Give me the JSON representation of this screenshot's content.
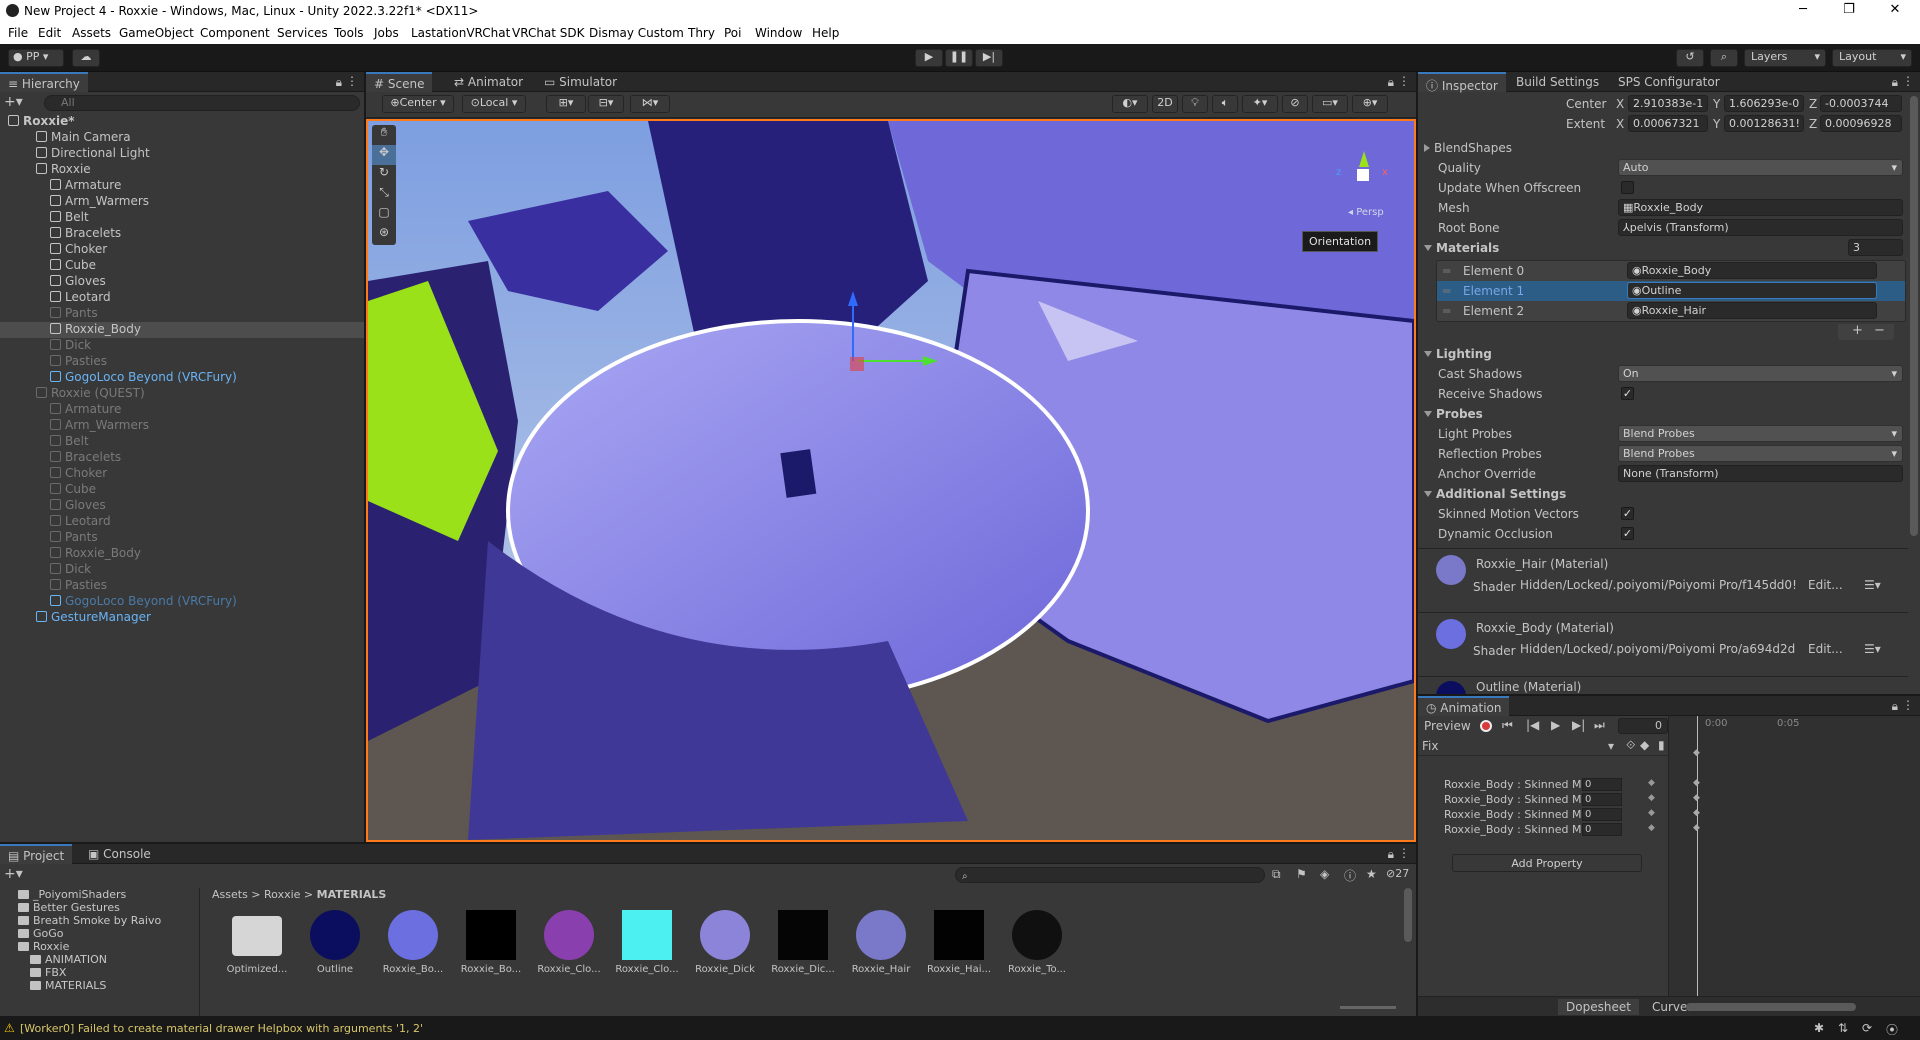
{
  "window": {
    "title": "New Project 4 - Roxxie - Windows, Mac, Linux - Unity 2022.3.22f1* <DX11>",
    "min": "─",
    "max": "❐",
    "close": "✕"
  },
  "menu": [
    "File",
    "Edit",
    "Assets",
    "GameObject",
    "Component",
    "Services",
    "Tools",
    "Jobs",
    "LastationVRChat",
    "VRChat SDK",
    "Dismay Custom",
    "Thry",
    "Poi",
    "Window",
    "Help"
  ],
  "toolbar": {
    "account": "PP",
    "layers": "Layers",
    "layout": "Layout"
  },
  "hierarchy": {
    "tab": "Hierarchy",
    "search_placeholder": "All",
    "rows": [
      {
        "label": "Roxxie*",
        "indent": 0,
        "style": "bold"
      },
      {
        "label": "Main Camera",
        "indent": 2,
        "style": "normal"
      },
      {
        "label": "Directional Light",
        "indent": 2,
        "style": "normal"
      },
      {
        "label": "Roxxie",
        "indent": 2,
        "style": "normal"
      },
      {
        "label": "Armature",
        "indent": 3,
        "style": "normal"
      },
      {
        "label": "Arm_Warmers",
        "indent": 3,
        "style": "normal"
      },
      {
        "label": "Belt",
        "indent": 3,
        "style": "normal"
      },
      {
        "label": "Bracelets",
        "indent": 3,
        "style": "normal"
      },
      {
        "label": "Choker",
        "indent": 3,
        "style": "normal"
      },
      {
        "label": "Cube",
        "indent": 3,
        "style": "normal"
      },
      {
        "label": "Gloves",
        "indent": 3,
        "style": "normal"
      },
      {
        "label": "Leotard",
        "indent": 3,
        "style": "normal"
      },
      {
        "label": "Pants",
        "indent": 3,
        "style": "dim"
      },
      {
        "label": "Roxxie_Body",
        "indent": 3,
        "style": "selected"
      },
      {
        "label": "Dick",
        "indent": 3,
        "style": "dim"
      },
      {
        "label": "Pasties",
        "indent": 3,
        "style": "dim"
      },
      {
        "label": "GogoLoco Beyond (VRCFury)",
        "indent": 3,
        "style": "blue"
      },
      {
        "label": "Roxxie (QUEST)",
        "indent": 2,
        "style": "dim"
      },
      {
        "label": "Armature",
        "indent": 3,
        "style": "dim"
      },
      {
        "label": "Arm_Warmers",
        "indent": 3,
        "style": "dim"
      },
      {
        "label": "Belt",
        "indent": 3,
        "style": "dim"
      },
      {
        "label": "Bracelets",
        "indent": 3,
        "style": "dim"
      },
      {
        "label": "Choker",
        "indent": 3,
        "style": "dim"
      },
      {
        "label": "Cube",
        "indent": 3,
        "style": "dim"
      },
      {
        "label": "Gloves",
        "indent": 3,
        "style": "dim"
      },
      {
        "label": "Leotard",
        "indent": 3,
        "style": "dim"
      },
      {
        "label": "Pants",
        "indent": 3,
        "style": "dim"
      },
      {
        "label": "Roxxie_Body",
        "indent": 3,
        "style": "dim"
      },
      {
        "label": "Dick",
        "indent": 3,
        "style": "dim"
      },
      {
        "label": "Pasties",
        "indent": 3,
        "style": "dim"
      },
      {
        "label": "GogoLoco Beyond (VRCFury)",
        "indent": 3,
        "style": "dimblue"
      },
      {
        "label": "GestureManager",
        "indent": 2,
        "style": "blue"
      }
    ]
  },
  "scene": {
    "tabs": [
      "Scene",
      "Animator",
      "Simulator"
    ],
    "pivot": "Center",
    "space": "Local",
    "mode2d": "2D",
    "persp": "◂ Persp",
    "tooltip": "Orientation",
    "axis_x": "x",
    "axis_z": "z"
  },
  "inspector": {
    "tabs": [
      "Inspector",
      "Build Settings",
      "SPS Configurator"
    ],
    "bounds": {
      "center_label": "Center",
      "extent_label": "Extent",
      "center": [
        "2.910383e-1",
        "1.606293e-0",
        "-0.0003744"
      ],
      "extent": [
        "0.00067321",
        "0.00128631!",
        "0.00096928"
      ],
      "axes": [
        "X",
        "Y",
        "Z"
      ]
    },
    "blendshapes": "BlendShapes",
    "quality_label": "Quality",
    "quality_value": "Auto",
    "update_offscreen_label": "Update When Offscreen",
    "mesh_label": "Mesh",
    "mesh_value": "Roxxie_Body",
    "rootbone_label": "Root Bone",
    "rootbone_value": "pelvis (Transform)",
    "materials_label": "Materials",
    "materials_count": "3",
    "elements": [
      {
        "label": "Element 0",
        "value": "Roxxie_Body"
      },
      {
        "label": "Element 1",
        "value": "Outline"
      },
      {
        "label": "Element 2",
        "value": "Roxxie_Hair"
      }
    ],
    "plus": "+",
    "minus": "−",
    "lighting": "Lighting",
    "cast_shadows_label": "Cast Shadows",
    "cast_shadows_value": "On",
    "receive_shadows_label": "Receive Shadows",
    "probes": "Probes",
    "light_probes_label": "Light Probes",
    "light_probes_value": "Blend Probes",
    "reflection_probes_label": "Reflection Probes",
    "reflection_probes_value": "Blend Probes",
    "anchor_label": "Anchor Override",
    "anchor_value": "None (Transform)",
    "additional": "Additional Settings",
    "skinned_motion_label": "Skinned Motion Vectors",
    "dynamic_occlusion_label": "Dynamic Occlusion",
    "materials": [
      {
        "name": "Roxxie_Hair (Material)",
        "shader_label": "Shader",
        "shader": "Hidden/Locked/.poiyomi/Poiyomi Pro/f145dd0!",
        "edit": "Edit..."
      },
      {
        "name": "Roxxie_Body (Material)",
        "shader_label": "Shader",
        "shader": "Hidden/Locked/.poiyomi/Poiyomi Pro/a694d2d",
        "edit": "Edit..."
      },
      {
        "name": "Outline (Material)"
      }
    ]
  },
  "animation": {
    "tab": "Animation",
    "preview": "Preview",
    "frame": "0",
    "clip": "Fix",
    "t0": "0:00",
    "t1": "0:05",
    "rows": [
      {
        "label": "Roxxie_Body : Skinned Mes",
        "value": "0"
      },
      {
        "label": "Roxxie_Body : Skinned Mes",
        "value": "0"
      },
      {
        "label": "Roxxie_Body : Skinned Mes",
        "value": "0"
      },
      {
        "label": "Roxxie_Body : Skinned Mes",
        "value": "0"
      }
    ],
    "add_property": "Add Property",
    "dopesheet": "Dopesheet",
    "curves": "Curves"
  },
  "project": {
    "tabs": [
      "Project",
      "Console"
    ],
    "tree": [
      {
        "label": "_PoiyomiShaders",
        "indent": 1
      },
      {
        "label": "Better Gestures",
        "indent": 1
      },
      {
        "label": "Breath Smoke by Raivo",
        "indent": 1
      },
      {
        "label": "GoGo",
        "indent": 1
      },
      {
        "label": "Roxxie",
        "indent": 1
      },
      {
        "label": "ANIMATION",
        "indent": 2
      },
      {
        "label": "FBX",
        "indent": 2
      },
      {
        "label": "MATERIALS",
        "indent": 2
      }
    ],
    "breadcrumb": [
      "Assets",
      "Roxxie",
      "MATERIALS"
    ],
    "hidden_count": "27",
    "assets": [
      {
        "label": "Optimized...",
        "kind": "folder",
        "color": "#d6d6d6"
      },
      {
        "label": "Outline",
        "kind": "sphere",
        "color": "#0b0e5e"
      },
      {
        "label": "Roxxie_Bo...",
        "kind": "sphere",
        "color": "#6b6fe0"
      },
      {
        "label": "Roxxie_Bo...",
        "kind": "tex",
        "color": "#000000"
      },
      {
        "label": "Roxxie_Clo...",
        "kind": "sphere",
        "color": "#8a3fae"
      },
      {
        "label": "Roxxie_Clo...",
        "kind": "tex",
        "color": "#4df0f0"
      },
      {
        "label": "Roxxie_Dick",
        "kind": "sphere",
        "color": "#8b84d8"
      },
      {
        "label": "Roxxie_Dic...",
        "kind": "tex",
        "color": "#050505"
      },
      {
        "label": "Roxxie_Hair",
        "kind": "sphere",
        "color": "#7a78c8"
      },
      {
        "label": "Roxxie_Hai...",
        "kind": "tex",
        "color": "#020202"
      },
      {
        "label": "Roxxie_To...",
        "kind": "sphere",
        "color": "#101010"
      }
    ]
  },
  "status": {
    "message": "[Worker0] Failed to create material drawer Helpbox with arguments '1, 2'"
  },
  "colors": {
    "accent": "#3a79bb",
    "warning": "#f5c400",
    "selection": "#2c5d87"
  }
}
